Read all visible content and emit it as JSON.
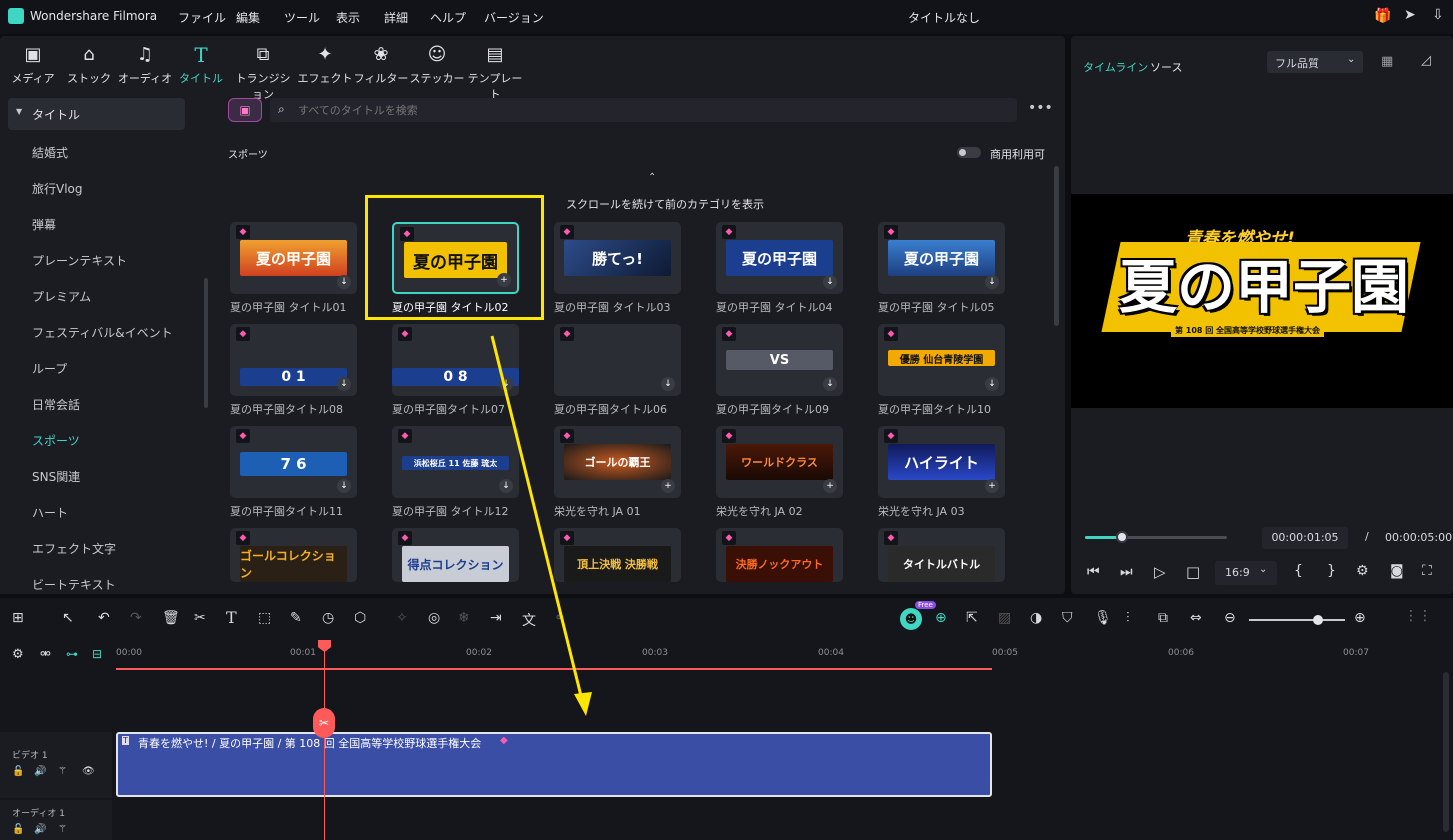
{
  "app": {
    "name": "Wondershare Filmora",
    "doc_title": "タイトルなし"
  },
  "menu": [
    "ファイル",
    "編集",
    "ツール",
    "表示",
    "詳細",
    "ヘルプ",
    "バージョン"
  ],
  "tools": [
    "メディア",
    "ストック",
    "オーディオ",
    "タイトル",
    "トランジション",
    "エフェクト",
    "フィルター",
    "ステッカー",
    "テンプレート"
  ],
  "sidebar": {
    "header": "タイトル",
    "items": [
      "結婚式",
      "旅行Vlog",
      "弾幕",
      "プレーンテキスト",
      "プレミアム",
      "フェスティバル&イベント",
      "ループ",
      "日常会話",
      "スポーツ",
      "SNS関連",
      "ハート",
      "エフェクト文字",
      "ビートテキスト"
    ],
    "active_index": 8
  },
  "search": {
    "placeholder": "すべてのタイトルを検索"
  },
  "section": {
    "name": "スポーツ",
    "commercial_label": "商用利用可",
    "scroll_hint": "スクロールを続けて前のカテゴリを表示"
  },
  "cards": [
    {
      "label": "夏の甲子園 タイトル01",
      "art": "夏の甲子園"
    },
    {
      "label": "夏の甲子園 タイトル02",
      "art": "夏の甲子園"
    },
    {
      "label": "夏の甲子園 タイトル03",
      "art": "勝てっ!"
    },
    {
      "label": "夏の甲子園 タイトル04",
      "art": "夏の甲子園"
    },
    {
      "label": "夏の甲子園 タイトル05",
      "art": "夏の甲子園"
    },
    {
      "label": "夏の甲子園タイトル08",
      "art": "0 1"
    },
    {
      "label": "夏の甲子園タイトル07",
      "art": "0 8"
    },
    {
      "label": "夏の甲子園タイトル06",
      "art": ""
    },
    {
      "label": "夏の甲子園タイトル09",
      "art": "VS"
    },
    {
      "label": "夏の甲子園タイトル10",
      "art": "優勝 仙台青陵学園"
    },
    {
      "label": "夏の甲子園タイトル11",
      "art": "7 6"
    },
    {
      "label": "夏の甲子園 タイトル12",
      "art": "浜松桜丘 11 佐藤 琉太"
    },
    {
      "label": "栄光を守れ JA 01",
      "art": "ゴールの覇王"
    },
    {
      "label": "栄光を守れ JA 02",
      "art": "ワールドクラス"
    },
    {
      "label": "栄光を守れ JA 03",
      "art": "ハイライト"
    },
    {
      "label": "",
      "art": "ゴールコレクション"
    },
    {
      "label": "",
      "art": "得点コレクション"
    },
    {
      "label": "",
      "art": "頂上決戦 決勝戦"
    },
    {
      "label": "",
      "art": "決勝ノックアウト"
    },
    {
      "label": "",
      "art": "タイトルバトル"
    }
  ],
  "preview": {
    "tabs": [
      "タイムライン",
      "ソース"
    ],
    "quality": "フル品質",
    "title_top": "青春を燃やせ!",
    "title_main": "夏の甲子園",
    "title_sub": "第 108 回 全国高等学校野球選手権大会",
    "current_time": "00:00:01:05",
    "separator": "/",
    "total_time": "00:00:05:00",
    "ratio": "16:9",
    "progress": 0.26
  },
  "timeline": {
    "ticks": [
      "00:00",
      "00:01",
      "00:02",
      "00:03",
      "00:04",
      "00:05",
      "00:06",
      "00:07"
    ],
    "video_track": "ビデオ 1",
    "audio_track": "オーディオ 1",
    "clip_text": "青春を燃やせ! / 夏の甲子園 / 第 108 回 全国高等学校野球選手権大会",
    "free_badge": "Free"
  },
  "colors": {
    "accent": "#3fd6c4",
    "playhead": "#ff5a5a",
    "clip": "#3b4ea6",
    "highlight": "#ffe600"
  }
}
